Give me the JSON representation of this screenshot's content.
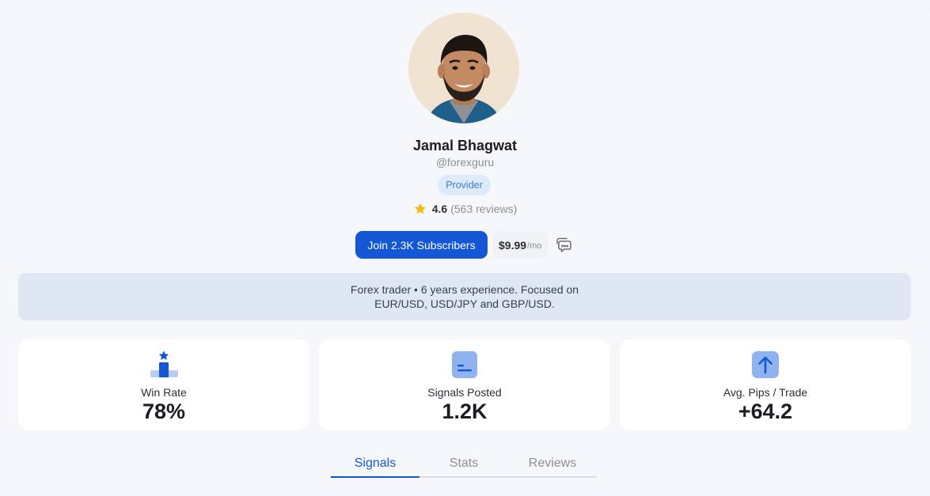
{
  "profile": {
    "name": "Jamal Bhagwat",
    "handle": "@forexguru",
    "badge": "Provider",
    "rating": "4.6",
    "reviews": "(563 reviews)"
  },
  "actions": {
    "join_label": "Join 2.3K Subscribers",
    "price": "$9.99",
    "price_period": "/mo"
  },
  "bio": {
    "line1": "Forex trader • 6 years experience. Focused on",
    "line2": "EUR/USD, USD/JPY and GBP/USD."
  },
  "stats": [
    {
      "label": "Win Rate",
      "value": "78%",
      "icon": "trophy-podium-icon"
    },
    {
      "label": "Signals Posted",
      "value": "1.2K",
      "icon": "document-icon"
    },
    {
      "label": "Avg. Pips / Trade",
      "value": "+64.2",
      "icon": "arrow-up-icon"
    }
  ],
  "tabs": [
    {
      "label": "Signals",
      "active": true
    },
    {
      "label": "Stats",
      "active": false
    },
    {
      "label": "Reviews",
      "active": false
    }
  ],
  "colors": {
    "primary": "#1457d6",
    "badge_bg": "#dceafa",
    "bio_bg": "#dfe7f4",
    "star": "#f5b914"
  }
}
